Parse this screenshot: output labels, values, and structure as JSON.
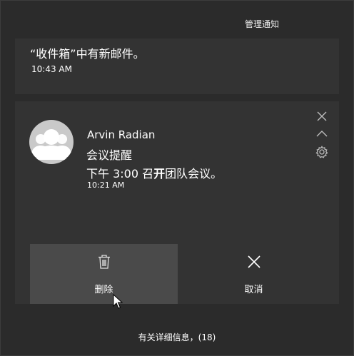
{
  "header": {
    "manage_label": "管理通知"
  },
  "notification_top": {
    "message": "“收件箱”中有新邮件。",
    "time": "10:43 AM"
  },
  "notification_main": {
    "sender": "Arvin Radian",
    "title": "会议提醒",
    "body_before": "下午 3:00 召",
    "body_bold": "开",
    "body_after": "团队会议。",
    "time": "10:21 AM",
    "actions": {
      "delete_label": "删除",
      "cancel_label": "取消"
    }
  },
  "footer": {
    "more_info_label": "有关详细信息，(18)"
  },
  "icons": {
    "avatar": "person-icon",
    "close": "close-icon",
    "collapse": "chevron-up-icon",
    "settings": "gear-icon",
    "delete": "trash-icon",
    "cancel": "x-icon"
  },
  "colors": {
    "panel_bg": "#2b2b2b",
    "card_bg": "#333333",
    "delete_button_bg": "#4a4a4a",
    "text": "#ffffff"
  }
}
